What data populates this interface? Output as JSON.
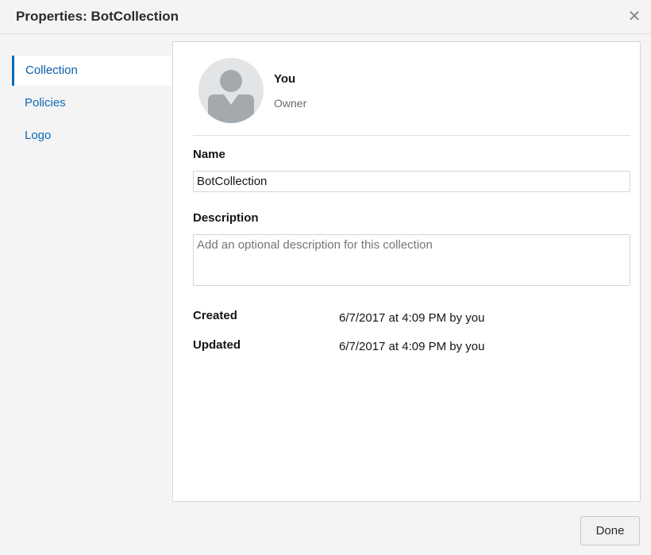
{
  "window": {
    "title": "Properties: BotCollection",
    "close_icon": "close-icon"
  },
  "sidebar": {
    "items": [
      {
        "label": "Collection",
        "active": true
      },
      {
        "label": "Policies",
        "active": false
      },
      {
        "label": "Logo",
        "active": false
      }
    ]
  },
  "owner": {
    "name": "You",
    "role": "Owner",
    "avatar_icon": "user-avatar-icon"
  },
  "form": {
    "name_label": "Name",
    "name_value": "BotCollection",
    "description_label": "Description",
    "description_placeholder": "Add an optional description for this collection",
    "description_value": ""
  },
  "meta": {
    "created_label": "Created",
    "created_value": "6/7/2017 at 4:09 PM by you",
    "updated_label": "Updated",
    "updated_value": "6/7/2017 at 4:09 PM by you"
  },
  "footer": {
    "done_label": "Done"
  },
  "colors": {
    "accent": "#0a6ab5",
    "link": "#0b6ab7",
    "background": "#f4f4f5"
  }
}
